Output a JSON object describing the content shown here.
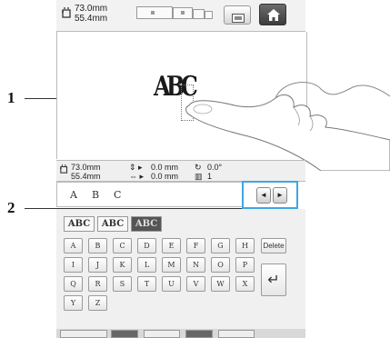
{
  "header": {
    "size_width": "73.0mm",
    "size_height": "55.4mm",
    "size_icon": "embroidery-size-icon",
    "view_icon": "image-view-icon",
    "home_icon": "home-icon"
  },
  "canvas": {
    "monogram_text": "ABC"
  },
  "info": {
    "width": "73.0mm",
    "height": "55.4mm",
    "vertical_offset": "0.0 mm",
    "horizontal_offset": "0.0 mm",
    "rotation": "0.0°",
    "color_count": "1"
  },
  "text_line": {
    "chars": [
      "A",
      "B",
      "C"
    ]
  },
  "nav": {
    "prev_label": "◄",
    "next_label": "►"
  },
  "font_tabs": [
    "ABC",
    "ABC",
    "ABC"
  ],
  "keyboard": {
    "row1": [
      "A",
      "B",
      "C",
      "D",
      "E",
      "F",
      "G",
      "H"
    ],
    "row2": [
      "I",
      "J",
      "K",
      "L",
      "M",
      "N",
      "O",
      "P"
    ],
    "row3": [
      "Q",
      "R",
      "S",
      "T",
      "U",
      "V",
      "W",
      "X"
    ],
    "row4": [
      "Y",
      "Z"
    ],
    "delete_label": "Delete",
    "enter_label": "↵"
  },
  "callouts": {
    "one": "1",
    "two": "2"
  },
  "colors": {
    "highlight": "#3fa6e0",
    "active_tab": "#555555"
  }
}
